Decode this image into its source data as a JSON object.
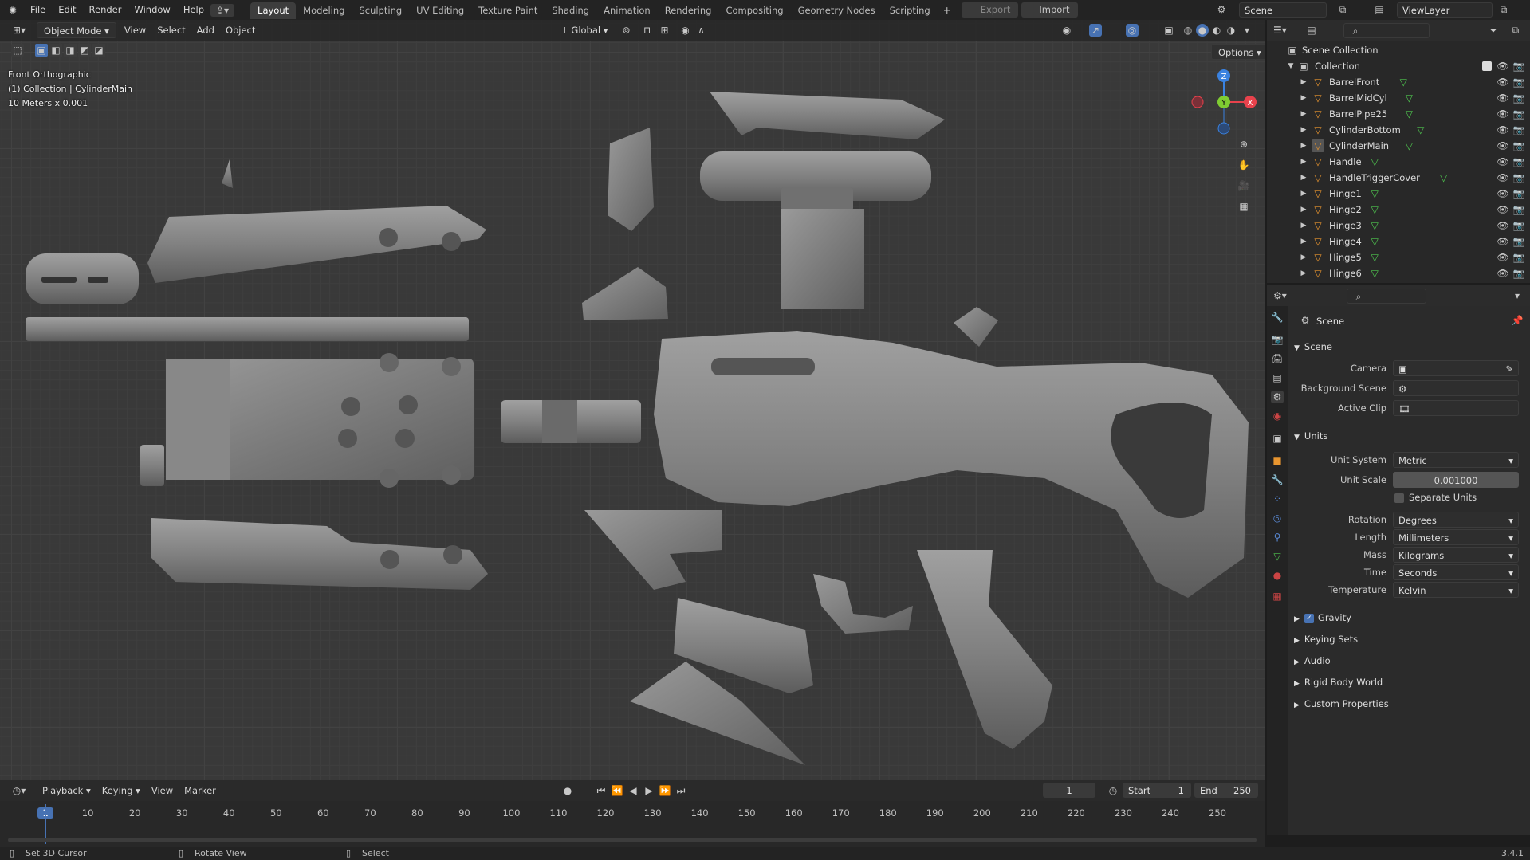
{
  "app": {
    "menus": [
      "File",
      "Edit",
      "Render",
      "Window",
      "Help"
    ],
    "version": "3.4.1"
  },
  "workspaces": {
    "tabs": [
      "Layout",
      "Modeling",
      "Sculpting",
      "UV Editing",
      "Texture Paint",
      "Shading",
      "Animation",
      "Rendering",
      "Compositing",
      "Geometry Nodes",
      "Scripting"
    ],
    "active": "Layout",
    "export_label": "Export",
    "import_label": "Import"
  },
  "scene_selector": {
    "scene": "Scene",
    "view_layer": "ViewLayer"
  },
  "viewport": {
    "mode": "Object Mode",
    "menus": [
      "View",
      "Select",
      "Add",
      "Object"
    ],
    "orientation": "Global",
    "options_label": "Options",
    "overlay_lines": [
      "Front Orthographic",
      "(1) Collection | CylinderMain",
      "10 Meters x 0.001"
    ],
    "gizmo": {
      "z": "Z",
      "y": "Y",
      "x": "X"
    }
  },
  "outliner": {
    "root": "Scene Collection",
    "collection": "Collection",
    "objects": [
      "BarrelFront",
      "BarrelMidCyl",
      "BarrelPipe25",
      "CylinderBottom",
      "CylinderMain",
      "Handle",
      "HandleTriggerCover",
      "Hinge1",
      "Hinge2",
      "Hinge3",
      "Hinge4",
      "Hinge5",
      "Hinge6"
    ]
  },
  "properties": {
    "header": "Scene",
    "scene_section": "Scene",
    "camera_label": "Camera",
    "background_scene_label": "Background Scene",
    "active_clip_label": "Active Clip",
    "units_section": "Units",
    "unit_system_label": "Unit System",
    "unit_system": "Metric",
    "unit_scale_label": "Unit Scale",
    "unit_scale": "0.001000",
    "separate_units_label": "Separate Units",
    "rotation_label": "Rotation",
    "rotation": "Degrees",
    "length_label": "Length",
    "length": "Millimeters",
    "mass_label": "Mass",
    "mass": "Kilograms",
    "time_label": "Time",
    "time": "Seconds",
    "temperature_label": "Temperature",
    "temperature": "Kelvin",
    "collapsed_sections": [
      "Gravity",
      "Keying Sets",
      "Audio",
      "Rigid Body World",
      "Custom Properties"
    ]
  },
  "timeline": {
    "menus": [
      "Playback",
      "Keying",
      "View",
      "Marker"
    ],
    "current_frame": "1",
    "start_label": "Start",
    "start": "1",
    "end_label": "End",
    "end": "250",
    "ticks": [
      "1",
      "10",
      "20",
      "30",
      "40",
      "50",
      "60",
      "70",
      "80",
      "90",
      "100",
      "110",
      "120",
      "130",
      "140",
      "150",
      "160",
      "170",
      "180",
      "190",
      "200",
      "210",
      "220",
      "230",
      "240",
      "250"
    ]
  },
  "status": {
    "left": "Set 3D Cursor",
    "middle": "Rotate View",
    "right": "Select"
  },
  "colors": {
    "accent": "#4772b3",
    "active_tab": "#3d3d3d",
    "mesh_icon": "#e8952f",
    "x_axis": "#e8424c",
    "y_axis": "#7fcc32",
    "z_axis": "#3a82e0"
  }
}
